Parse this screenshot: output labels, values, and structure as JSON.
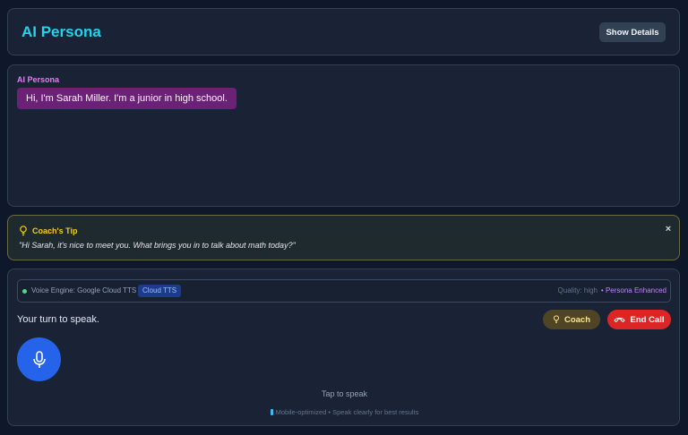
{
  "header": {
    "title": "AI Persona",
    "show_details_label": "Show Details"
  },
  "chat": {
    "speaker": "AI Persona",
    "message": "Hi, I'm Sarah Miller. I'm a junior in high school."
  },
  "coach_tip": {
    "title": "Coach's Tip",
    "text": "\"Hi Sarah, it's nice to meet you. What brings you in to talk about math today?\"",
    "close_label": "×"
  },
  "voice": {
    "engine_label": "Voice Engine: Google Cloud TTS",
    "engine_badge": "Cloud TTS",
    "quality": "Quality: high",
    "persona_enhanced": "• Persona Enhanced",
    "status_text": "Your turn to speak.",
    "coach_label": "Coach",
    "end_call_label": "End Call",
    "tap_to_speak": "Tap to speak",
    "footer": "Mobile-optimized • Speak clearly for best results"
  },
  "colors": {
    "accent": "#22d3ee",
    "persona": "#e879f9",
    "bubble": "#6b2176",
    "tip": "#facc15",
    "mic": "#2563eb",
    "end_call": "#dc2626",
    "status_dot": "#4ade80"
  },
  "icons": [
    "lightbulb-icon",
    "close-icon",
    "status-dot-icon",
    "microphone-icon",
    "phone-hangup-icon",
    "mobile-icon"
  ]
}
